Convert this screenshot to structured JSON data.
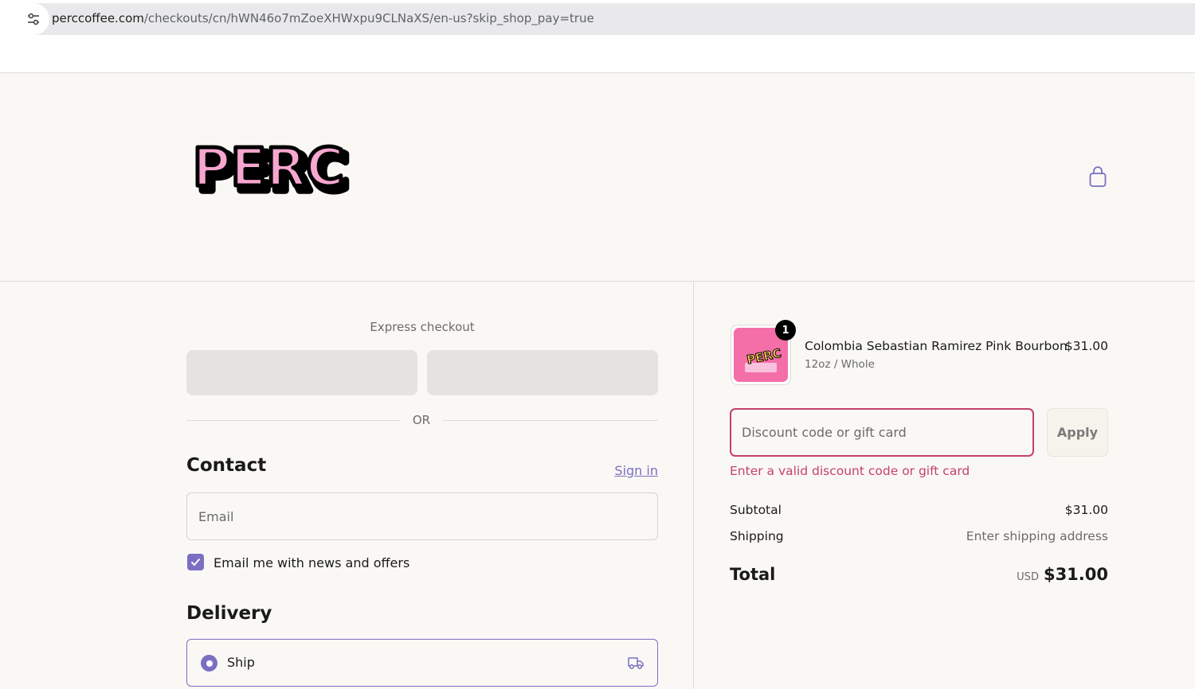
{
  "browser": {
    "url_host": "perccoffee.com",
    "url_path": "/checkouts/cn/hWN46o7mZoeXHWxpu9CLNaXS/en-us?skip_shop_pay=true",
    "site_info_icon": "tune-icon"
  },
  "header": {
    "logo_text": "PERC",
    "cart_icon": "shopping-bag-icon"
  },
  "express": {
    "title": "Express checkout",
    "or_label": "OR"
  },
  "contact": {
    "heading": "Contact",
    "sign_in_label": "Sign in",
    "email_placeholder": "Email",
    "newsletter_label": "Email me with news and offers",
    "newsletter_checked": true
  },
  "delivery": {
    "heading": "Delivery",
    "ship_label": "Ship",
    "ship_icon": "truck-icon"
  },
  "summary": {
    "item": {
      "quantity": "1",
      "name": "Colombia Sebastian Ramirez Pink Bourbon",
      "variant": "12oz / Whole",
      "price": "$31.00"
    },
    "discount_placeholder": "Discount code or gift card",
    "apply_label": "Apply",
    "discount_error": "Enter a valid discount code or gift card",
    "subtotal_label": "Subtotal",
    "subtotal_value": "$31.00",
    "shipping_label": "Shipping",
    "shipping_value": "Enter shipping address",
    "total_label": "Total",
    "total_currency": "USD",
    "total_value": "$31.00"
  },
  "colors": {
    "accent": "#7b6fc2",
    "error": "#c4416b",
    "brand_pink": "#f7a6cf",
    "background": "#faf8f5"
  }
}
